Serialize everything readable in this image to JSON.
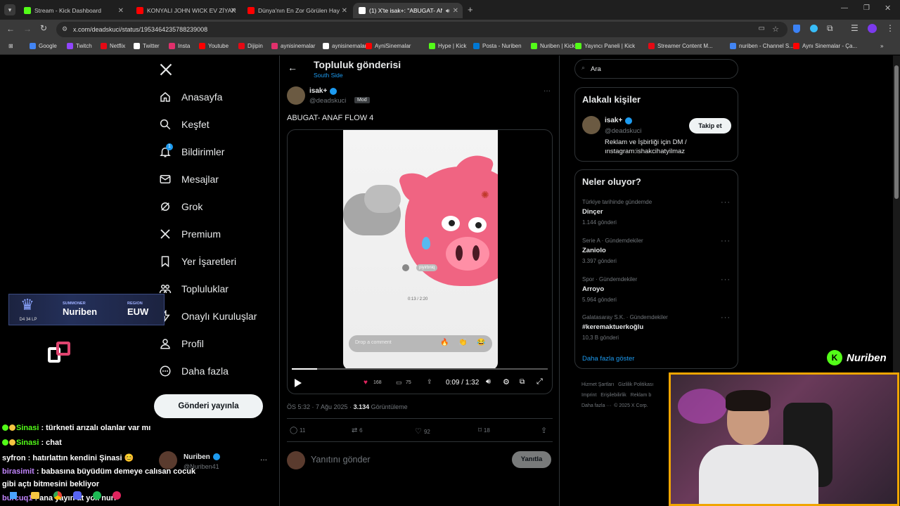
{
  "browser": {
    "tabs": [
      {
        "title": "Stream - Kick Dashboard",
        "color": "#53fc18"
      },
      {
        "title": "KONYALI JOHN WICK EV ZİYAR",
        "color": "#ff0000"
      },
      {
        "title": "Dünya'nın En Zor Görülen Hay",
        "color": "#ff0000"
      },
      {
        "title": "(1) X'te isak+: \"ABUGAT- AN",
        "color": "#ffffff"
      }
    ],
    "url": "x.com/deadskuci/status/1953464235788239008",
    "bookmarks": [
      {
        "label": "Google",
        "color": "#4285f4"
      },
      {
        "label": "Twitch",
        "color": "#9146ff"
      },
      {
        "label": "Netflix",
        "color": "#e50914"
      },
      {
        "label": "Twitter",
        "color": "#ffffff"
      },
      {
        "label": "Insta",
        "color": "#e1306c"
      },
      {
        "label": "Youtube",
        "color": "#ff0000"
      },
      {
        "label": "Dijipin",
        "color": "#e50914"
      },
      {
        "label": "aynisinemalar",
        "color": "#e1306c"
      },
      {
        "label": "aynisinemalar",
        "color": "#ffffff"
      },
      {
        "label": "AyniSinemalar",
        "color": "#ff0000"
      },
      {
        "label": "Hype | Kick",
        "color": "#53fc18"
      },
      {
        "label": "Posta - Nuriben",
        "color": "#0078d4"
      },
      {
        "label": "Nuriben | Kick",
        "color": "#53fc18"
      },
      {
        "label": "Yayıncı Paneli | Kick",
        "color": "#53fc18"
      },
      {
        "label": "Streamer Content M...",
        "color": "#e50914"
      },
      {
        "label": "nuriben - Channel S...",
        "color": "#4285f4"
      },
      {
        "label": "Aynı Sinemalar - Ça...",
        "color": "#ff0000"
      }
    ]
  },
  "nav": {
    "items": [
      "Anasayfa",
      "Keşfet",
      "Bildirimler",
      "Mesajlar",
      "Grok",
      "Premium",
      "Yer İşaretleri",
      "Topluluklar",
      "Onaylı Kuruluşlar",
      "Profil",
      "Daha fazla"
    ],
    "notification_count": "1",
    "post_button": "Gönderi yayınla",
    "account_name": "Nuriben",
    "account_handle": "@Nuriben41"
  },
  "post": {
    "header_title": "Topluluk gönderisi",
    "header_sub": "South Side",
    "author_name": "isak+",
    "author_handle": "@deadskuci",
    "role_badge": "Mod",
    "text": "ABUGAT- ANAF FLOW 4",
    "video": {
      "current": "0:09",
      "total": "1:32",
      "progress": 0.098,
      "inner_likes": "168",
      "inner_comments": "75",
      "comment_placeholder": "Drop a comment",
      "inner_time": "0:13 / 2:20",
      "inner_user": "piyirbniq"
    },
    "timestamp": "ÖS 5:32 · 7 Ağu 2025 · ",
    "views_count": "3.134",
    "views_label": " Görüntüleme",
    "actions": {
      "replies": "11",
      "reposts": "6",
      "likes": "92",
      "bookmarks": "18"
    },
    "reply_placeholder": "Yanıtını gönder",
    "reply_button": "Yanıtla"
  },
  "sidebar": {
    "search_placeholder": "Ara",
    "related_title": "Alakalı kişiler",
    "related": {
      "name": "isak+",
      "handle": "@deadskuci",
      "follow": "Takip et",
      "bio": "Reklam ve İşbirliği için DM / ınstagram:ishakcihatyilmaz"
    },
    "trends_title": "Neler oluyor?",
    "trends": [
      {
        "context": "Türkiye tarihinde gündemde",
        "name": "Dinçer",
        "count": "1.144 gönderi"
      },
      {
        "context": "Serie A · Gündemdekiler",
        "name": "Zaniolo",
        "count": "3.397 gönderi"
      },
      {
        "context": "Spor · Gündemdekiler",
        "name": "Arroyo",
        "count": "5.964 gönderi"
      },
      {
        "context": "Galatasaray S.K. · Gündemdekiler",
        "name": "#keremaktuerkoğlu",
        "count": "10,3 B gönderi"
      }
    ],
    "show_more": "Daha fazla göster",
    "footer": [
      "Hizmet Şartları",
      "Gizlilik Politikası",
      "Imprint",
      "Erişilebilirlik",
      "Reklam b",
      "Daha fazla ···",
      "© 2025 X Corp."
    ]
  },
  "overlay": {
    "summoner_label": "SUMMONER",
    "summoner_name": "Nuriben",
    "region_label": "REGION",
    "region": "EUW",
    "lp": "D4 34 LP",
    "kick_name": "Nuriben",
    "chat": [
      {
        "user": "Sinasi",
        "color": "#53fc18",
        "msg": " : türkneti arızalı olanlar var mı"
      },
      {
        "user": "Sinasi",
        "color": "#53fc18",
        "msg": " : chat"
      },
      {
        "user": "syfron",
        "color": "#ffffff",
        "msg": " : hatırlattın kendini Şinasi 😊"
      },
      {
        "user": "birasimit",
        "color": "#c084fc",
        "msg": " : babasına büyüdüm demeye calısan cocuk"
      },
      {
        "user": "",
        "color": "#ffffff",
        "msg": "gibi açtı bitmesini bekliyor"
      },
      {
        "user": "burcuq1",
        "color": "#c084fc",
        "msg": " : ana yayın at yok nuri"
      }
    ]
  },
  "colors": {
    "accent": "#1d9bf0",
    "kick": "#53fc18",
    "webcam_border": "#f0a500"
  }
}
